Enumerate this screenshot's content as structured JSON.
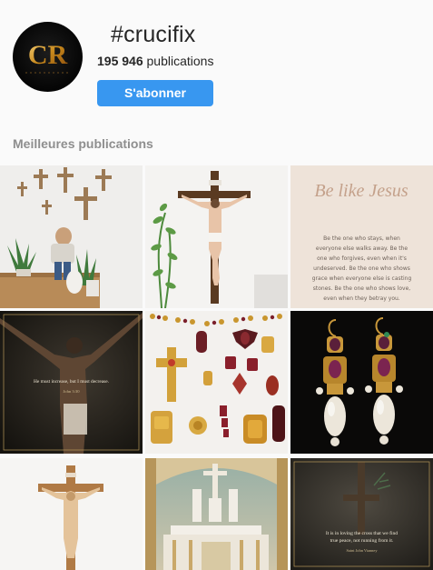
{
  "profile": {
    "avatar_text": "CR",
    "hashtag": "#crucifix",
    "post_count": "195 946",
    "post_count_label": "publications",
    "follow_label": "S'abonner"
  },
  "top_posts": {
    "title": "Meilleures publications",
    "posts": [
      {
        "label": "post-crosses-wall"
      },
      {
        "label": "post-crucifix-plant"
      },
      {
        "label": "post-be-like-jesus",
        "script_title": "Be like Jesus",
        "lines": [
          "Be the one who stays, when",
          "everyone else walks away. Be the",
          "one who forgives, even when it's",
          "undeserved. Be the one who shows",
          "grace when everyone else is casting",
          "stones. Be the one who shows love,",
          "even when they betray you."
        ]
      },
      {
        "label": "post-crucifix-quote",
        "quote": "He must increase, but I must decrease.",
        "cite": "John 3:30"
      },
      {
        "label": "post-jewelry"
      },
      {
        "label": "post-earrings"
      },
      {
        "label": "post-wooden-crucifix"
      },
      {
        "label": "post-altar"
      },
      {
        "label": "post-cross-quote",
        "quote_lines": [
          "It is in loving the cross that we find",
          "true peace, not running from it."
        ],
        "cite": "Saint John Vianney"
      }
    ]
  },
  "colors": {
    "accent": "#3897f0",
    "background": "#fafafa",
    "text": "#262626",
    "muted": "#8e8e8e"
  }
}
